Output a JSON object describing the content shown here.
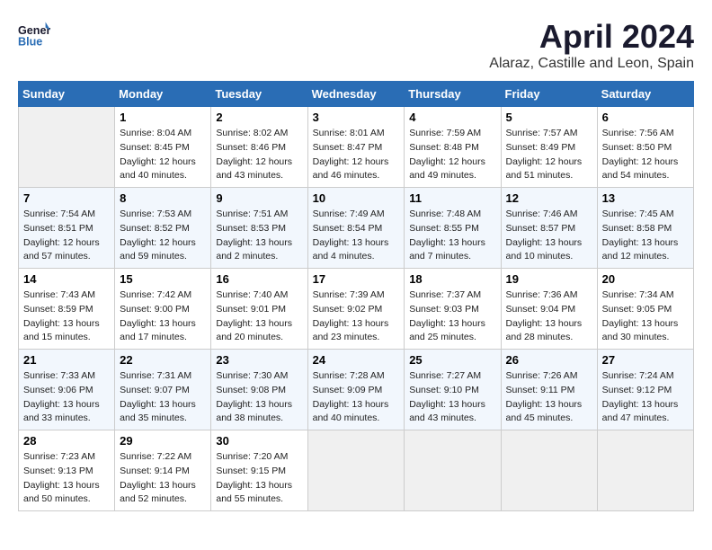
{
  "header": {
    "logo_line1": "General",
    "logo_line2": "Blue",
    "month_title": "April 2024",
    "subtitle": "Alaraz, Castille and Leon, Spain"
  },
  "days_of_week": [
    "Sunday",
    "Monday",
    "Tuesday",
    "Wednesday",
    "Thursday",
    "Friday",
    "Saturday"
  ],
  "weeks": [
    [
      {
        "day": "",
        "sunrise": "",
        "sunset": "",
        "daylight": ""
      },
      {
        "day": "1",
        "sunrise": "Sunrise: 8:04 AM",
        "sunset": "Sunset: 8:45 PM",
        "daylight": "Daylight: 12 hours and 40 minutes."
      },
      {
        "day": "2",
        "sunrise": "Sunrise: 8:02 AM",
        "sunset": "Sunset: 8:46 PM",
        "daylight": "Daylight: 12 hours and 43 minutes."
      },
      {
        "day": "3",
        "sunrise": "Sunrise: 8:01 AM",
        "sunset": "Sunset: 8:47 PM",
        "daylight": "Daylight: 12 hours and 46 minutes."
      },
      {
        "day": "4",
        "sunrise": "Sunrise: 7:59 AM",
        "sunset": "Sunset: 8:48 PM",
        "daylight": "Daylight: 12 hours and 49 minutes."
      },
      {
        "day": "5",
        "sunrise": "Sunrise: 7:57 AM",
        "sunset": "Sunset: 8:49 PM",
        "daylight": "Daylight: 12 hours and 51 minutes."
      },
      {
        "day": "6",
        "sunrise": "Sunrise: 7:56 AM",
        "sunset": "Sunset: 8:50 PM",
        "daylight": "Daylight: 12 hours and 54 minutes."
      }
    ],
    [
      {
        "day": "7",
        "sunrise": "Sunrise: 7:54 AM",
        "sunset": "Sunset: 8:51 PM",
        "daylight": "Daylight: 12 hours and 57 minutes."
      },
      {
        "day": "8",
        "sunrise": "Sunrise: 7:53 AM",
        "sunset": "Sunset: 8:52 PM",
        "daylight": "Daylight: 12 hours and 59 minutes."
      },
      {
        "day": "9",
        "sunrise": "Sunrise: 7:51 AM",
        "sunset": "Sunset: 8:53 PM",
        "daylight": "Daylight: 13 hours and 2 minutes."
      },
      {
        "day": "10",
        "sunrise": "Sunrise: 7:49 AM",
        "sunset": "Sunset: 8:54 PM",
        "daylight": "Daylight: 13 hours and 4 minutes."
      },
      {
        "day": "11",
        "sunrise": "Sunrise: 7:48 AM",
        "sunset": "Sunset: 8:55 PM",
        "daylight": "Daylight: 13 hours and 7 minutes."
      },
      {
        "day": "12",
        "sunrise": "Sunrise: 7:46 AM",
        "sunset": "Sunset: 8:57 PM",
        "daylight": "Daylight: 13 hours and 10 minutes."
      },
      {
        "day": "13",
        "sunrise": "Sunrise: 7:45 AM",
        "sunset": "Sunset: 8:58 PM",
        "daylight": "Daylight: 13 hours and 12 minutes."
      }
    ],
    [
      {
        "day": "14",
        "sunrise": "Sunrise: 7:43 AM",
        "sunset": "Sunset: 8:59 PM",
        "daylight": "Daylight: 13 hours and 15 minutes."
      },
      {
        "day": "15",
        "sunrise": "Sunrise: 7:42 AM",
        "sunset": "Sunset: 9:00 PM",
        "daylight": "Daylight: 13 hours and 17 minutes."
      },
      {
        "day": "16",
        "sunrise": "Sunrise: 7:40 AM",
        "sunset": "Sunset: 9:01 PM",
        "daylight": "Daylight: 13 hours and 20 minutes."
      },
      {
        "day": "17",
        "sunrise": "Sunrise: 7:39 AM",
        "sunset": "Sunset: 9:02 PM",
        "daylight": "Daylight: 13 hours and 23 minutes."
      },
      {
        "day": "18",
        "sunrise": "Sunrise: 7:37 AM",
        "sunset": "Sunset: 9:03 PM",
        "daylight": "Daylight: 13 hours and 25 minutes."
      },
      {
        "day": "19",
        "sunrise": "Sunrise: 7:36 AM",
        "sunset": "Sunset: 9:04 PM",
        "daylight": "Daylight: 13 hours and 28 minutes."
      },
      {
        "day": "20",
        "sunrise": "Sunrise: 7:34 AM",
        "sunset": "Sunset: 9:05 PM",
        "daylight": "Daylight: 13 hours and 30 minutes."
      }
    ],
    [
      {
        "day": "21",
        "sunrise": "Sunrise: 7:33 AM",
        "sunset": "Sunset: 9:06 PM",
        "daylight": "Daylight: 13 hours and 33 minutes."
      },
      {
        "day": "22",
        "sunrise": "Sunrise: 7:31 AM",
        "sunset": "Sunset: 9:07 PM",
        "daylight": "Daylight: 13 hours and 35 minutes."
      },
      {
        "day": "23",
        "sunrise": "Sunrise: 7:30 AM",
        "sunset": "Sunset: 9:08 PM",
        "daylight": "Daylight: 13 hours and 38 minutes."
      },
      {
        "day": "24",
        "sunrise": "Sunrise: 7:28 AM",
        "sunset": "Sunset: 9:09 PM",
        "daylight": "Daylight: 13 hours and 40 minutes."
      },
      {
        "day": "25",
        "sunrise": "Sunrise: 7:27 AM",
        "sunset": "Sunset: 9:10 PM",
        "daylight": "Daylight: 13 hours and 43 minutes."
      },
      {
        "day": "26",
        "sunrise": "Sunrise: 7:26 AM",
        "sunset": "Sunset: 9:11 PM",
        "daylight": "Daylight: 13 hours and 45 minutes."
      },
      {
        "day": "27",
        "sunrise": "Sunrise: 7:24 AM",
        "sunset": "Sunset: 9:12 PM",
        "daylight": "Daylight: 13 hours and 47 minutes."
      }
    ],
    [
      {
        "day": "28",
        "sunrise": "Sunrise: 7:23 AM",
        "sunset": "Sunset: 9:13 PM",
        "daylight": "Daylight: 13 hours and 50 minutes."
      },
      {
        "day": "29",
        "sunrise": "Sunrise: 7:22 AM",
        "sunset": "Sunset: 9:14 PM",
        "daylight": "Daylight: 13 hours and 52 minutes."
      },
      {
        "day": "30",
        "sunrise": "Sunrise: 7:20 AM",
        "sunset": "Sunset: 9:15 PM",
        "daylight": "Daylight: 13 hours and 55 minutes."
      },
      {
        "day": "",
        "sunrise": "",
        "sunset": "",
        "daylight": ""
      },
      {
        "day": "",
        "sunrise": "",
        "sunset": "",
        "daylight": ""
      },
      {
        "day": "",
        "sunrise": "",
        "sunset": "",
        "daylight": ""
      },
      {
        "day": "",
        "sunrise": "",
        "sunset": "",
        "daylight": ""
      }
    ]
  ]
}
